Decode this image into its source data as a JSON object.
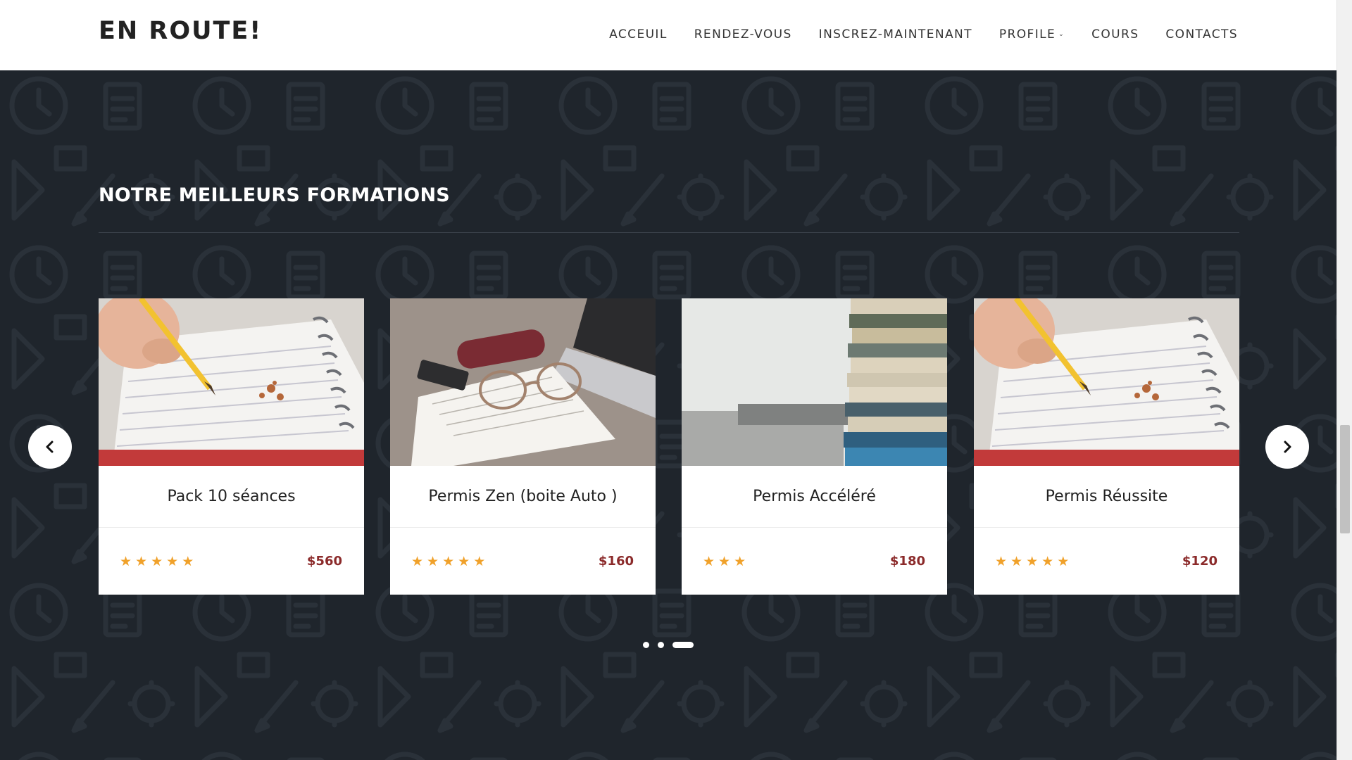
{
  "brand": {
    "name": "EN ROUTE!"
  },
  "nav": {
    "items": [
      {
        "label": "ACCEUIL"
      },
      {
        "label": "RENDEZ-VOUS"
      },
      {
        "label": "INSCREZ-MAINTENANT"
      },
      {
        "label": "PROFILE",
        "has_dropdown": true
      },
      {
        "label": "COURS"
      },
      {
        "label": "CONTACTS"
      }
    ]
  },
  "section": {
    "title": "NOTRE MEILLEURS FORMATIONS"
  },
  "cards": [
    {
      "title": "Pack 10 séances",
      "rating": 5,
      "price": "$560",
      "image": "pencil-notebook-photo"
    },
    {
      "title": "Permis Zen (boite Auto )",
      "rating": 5,
      "price": "$160",
      "image": "glasses-notebook-laptop-photo"
    },
    {
      "title": "Permis Accéléré",
      "rating": 3,
      "price": "$180",
      "image": "book-stack-photo"
    },
    {
      "title": "Permis Réussite",
      "rating": 5,
      "price": "$120",
      "image": "pencil-notebook-photo"
    }
  ],
  "carousel": {
    "dot_count": 3,
    "active_dot": 3
  },
  "colors": {
    "background": "#1f252c",
    "star": "#f0a12a",
    "price": "#8b2a2a"
  },
  "icons": {
    "prev": "chevron-left-icon",
    "next": "chevron-right-icon",
    "star": "star-icon",
    "dropdown": "chevron-down-icon"
  }
}
